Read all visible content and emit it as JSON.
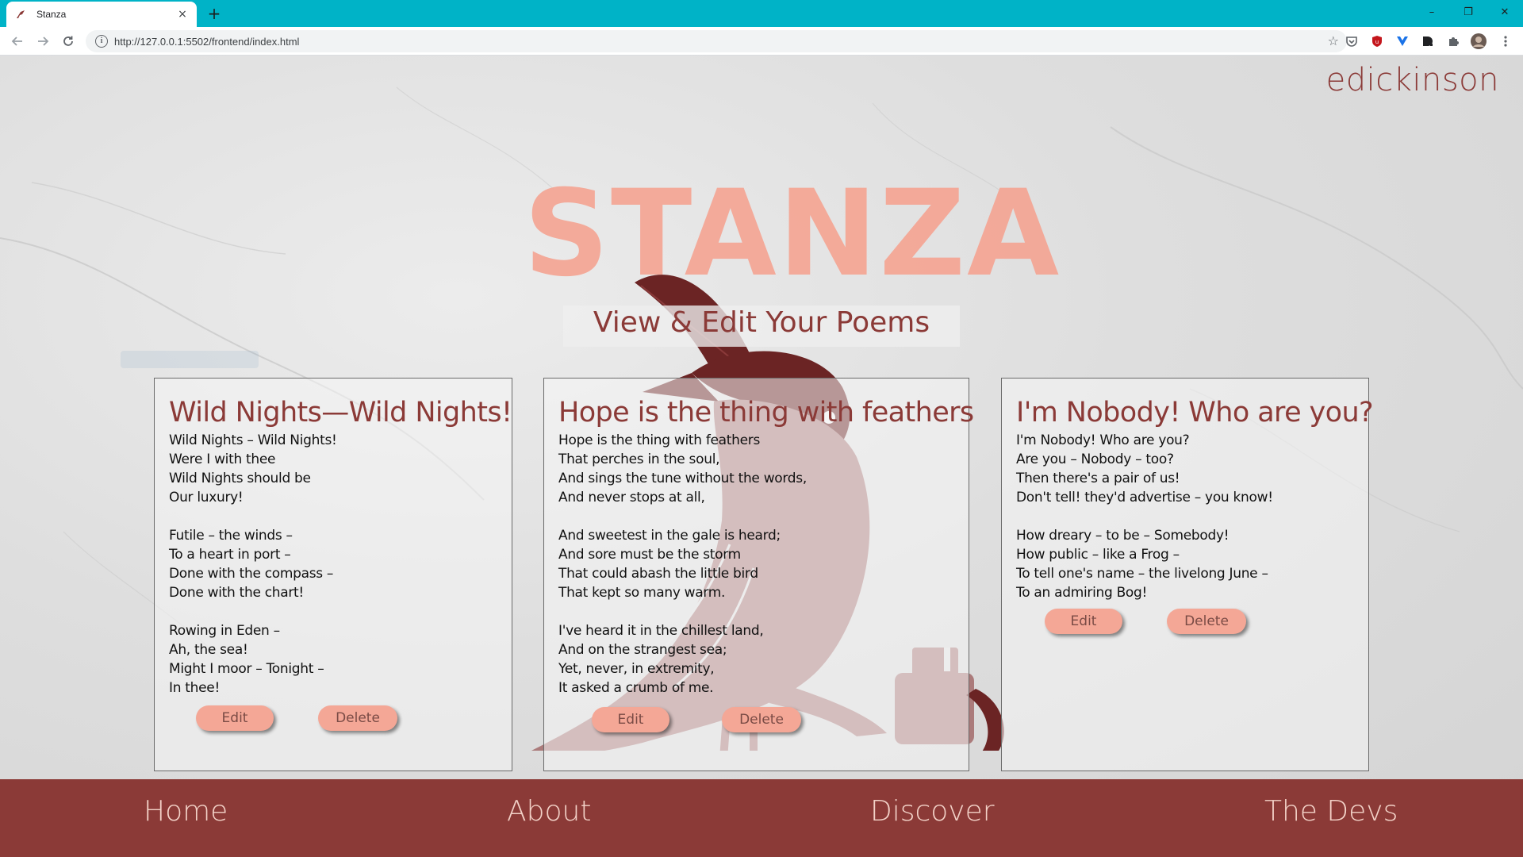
{
  "browser": {
    "tab_title": "Stanza",
    "tab_close": "×",
    "new_tab": "+",
    "url": "http://127.0.0.1:5502/frontend/index.html",
    "window_controls": {
      "minimize": "–",
      "restore": "❐",
      "close": "✕"
    }
  },
  "header": {
    "username": "edickinson",
    "logo": "STANZA",
    "subtitle": "View & Edit Your Poems"
  },
  "poems": [
    {
      "title": "Wild Nights—Wild Nights!",
      "body": "Wild Nights – Wild Nights!\nWere I with thee\nWild Nights should be\nOur luxury!\n\nFutile – the winds –\nTo a heart in port –\nDone with the compass –\nDone with the chart!\n\nRowing in Eden –\nAh, the sea!\nMight I moor – Tonight –\nIn thee!",
      "edit_label": "Edit",
      "delete_label": "Delete"
    },
    {
      "title": "Hope is the thing with feathers",
      "body": "Hope is the thing with feathers\nThat perches in the soul,\nAnd sings the tune without the words,\nAnd never stops at all,\n\nAnd sweetest in the gale is heard;\nAnd sore must be the storm\nThat could abash the little bird\nThat kept so many warm.\n\nI've heard it in the chillest land,\nAnd on the strangest sea;\nYet, never, in extremity,\nIt asked a crumb of me.",
      "edit_label": "Edit",
      "delete_label": "Delete"
    },
    {
      "title": "I'm Nobody! Who are you?",
      "body": "I'm Nobody! Who are you?\nAre you – Nobody – too?\nThen there's a pair of us!\nDon't tell! they'd advertise – you know!\n\nHow dreary – to be – Somebody!\nHow public – like a Frog –\nTo tell one's name – the livelong June –\nTo an admiring Bog!",
      "edit_label": "Edit",
      "delete_label": "Delete"
    }
  ],
  "footer": {
    "links": [
      "Home",
      "About",
      "Discover",
      "The Devs"
    ]
  },
  "colors": {
    "accent": "#8b3a37",
    "button": "#f4a796",
    "tabbar": "#00b3c7"
  }
}
